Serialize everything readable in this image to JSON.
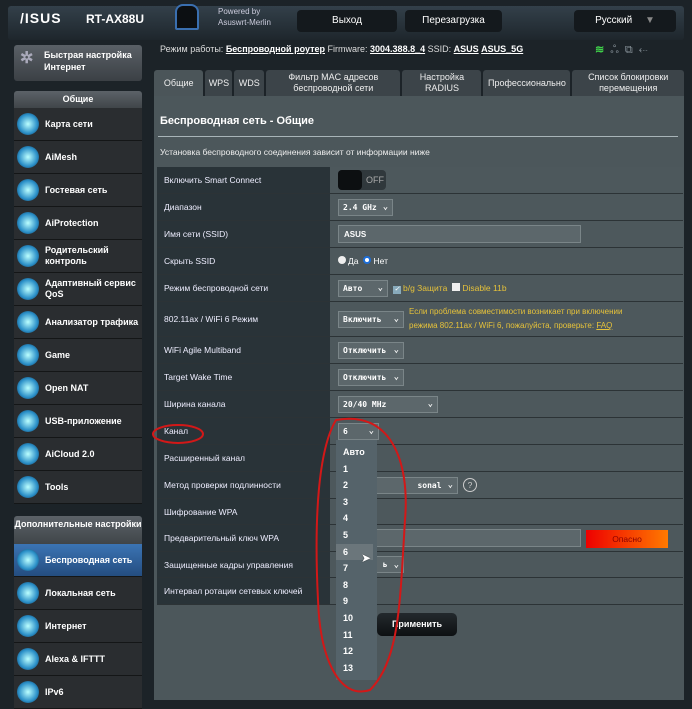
{
  "header": {
    "brand": "/ISUS",
    "model": "RT-AX88U",
    "powered_by": "Powered by",
    "merlin": "Asuswrt-Merlin",
    "logout": "Выход",
    "reboot": "Перезагрузка",
    "language": "Русский"
  },
  "status": {
    "mode_label": "Режим работы:",
    "mode": "Беспроводной роутер",
    "fw_label": "Firmware:",
    "fw": "3004.388.8_4",
    "ssid_label": "SSID:",
    "ssid1": "ASUS",
    "ssid2": "ASUS_5G"
  },
  "sidebar": {
    "quick_setup": "Быстрая настройка Интернет",
    "general_header": "Общие",
    "general": [
      "Карта сети",
      "AiMesh",
      "Гостевая сеть",
      "AiProtection",
      "Родительский контроль",
      "Адаптивный сервис QoS",
      "Анализатор трафика",
      "Game",
      "Open NAT",
      "USB-приложение",
      "AiCloud 2.0",
      "Tools"
    ],
    "advanced_header": "Дополнительные настройки",
    "advanced": [
      "Беспроводная сеть",
      "Локальная сеть",
      "Интернет",
      "Alexa & IFTTT",
      "IPv6"
    ]
  },
  "tabs": [
    "Общие",
    "WPS",
    "WDS",
    "Фильтр MAC адресов беспроводной сети",
    "Настройка RADIUS",
    "Профессионально",
    "Список блокировки перемещения"
  ],
  "panel": {
    "title": "Беспроводная сеть - Общие",
    "subtitle": "Установка беспроводного соединения зависит от информации ниже"
  },
  "rows": {
    "smart_connect": {
      "label": "Включить Smart Connect",
      "value": "OFF"
    },
    "band": {
      "label": "Диапазон",
      "value": "2.4 GHz"
    },
    "ssid": {
      "label": "Имя сети (SSID)",
      "value": "ASUS"
    },
    "hide_ssid": {
      "label": "Скрыть SSID",
      "yes": "Да",
      "no": "Нет"
    },
    "wireless_mode": {
      "label": "Режим беспроводной сети",
      "value": "Авто",
      "bg_protection": "b/g Защита",
      "disable_11b": "Disable 11b"
    },
    "ax_mode": {
      "label": "802.11ax / WiFi 6 Режим",
      "value": "Включить",
      "warning": "Если проблема совместимости возникает при включении режима 802.11ax / WiFi 6, пожалуйста, проверьте:",
      "faq": "FAQ"
    },
    "multiband": {
      "label": "WiFi Agile Multiband",
      "value": "Отключить"
    },
    "twt": {
      "label": "Target Wake Time",
      "value": "Отключить"
    },
    "bandwidth": {
      "label": "Ширина канала",
      "value": "20/40 MHz"
    },
    "channel": {
      "label": "Канал",
      "value": "6"
    },
    "ext_channel": {
      "label": "Расширенный канал"
    },
    "auth": {
      "label": "Метод проверки подлинности",
      "value": "sonal"
    },
    "wpa_enc": {
      "label": "Шифрование WPA"
    },
    "wpa_key": {
      "label": "Предварительный ключ WPA",
      "strength": "Опасно"
    },
    "pmf": {
      "label": "Защищенные кадры управления",
      "value": "ь"
    },
    "rekey": {
      "label": "Интервал ротации сетевых ключей"
    }
  },
  "apply": "Применить",
  "channel_options": [
    "Авто",
    "1",
    "2",
    "3",
    "4",
    "5",
    "6",
    "7",
    "8",
    "9",
    "10",
    "11",
    "12",
    "13"
  ],
  "channel_selected": "6"
}
